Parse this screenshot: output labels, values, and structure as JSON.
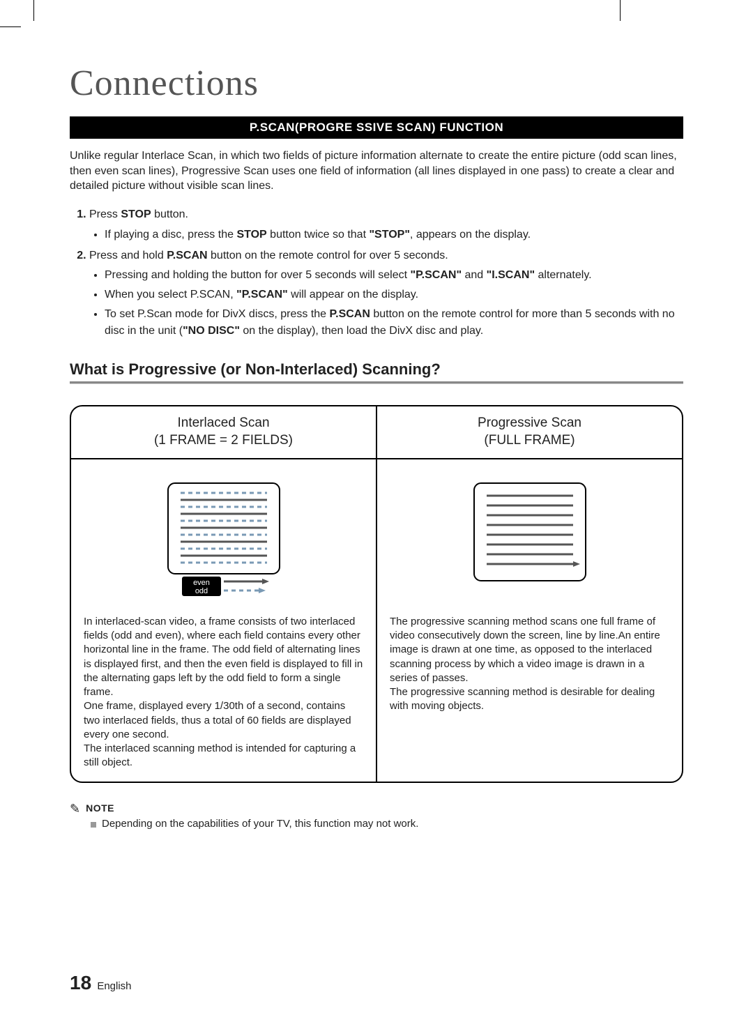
{
  "title": "Connections",
  "bar_heading": "P.SCAN(PROGRE SSIVE SCAN) FUNCTION",
  "intro": "Unlike regular Interlace Scan, in which two fields of picture information alternate to create the entire picture (odd scan lines, then even scan lines), Progressive Scan uses one field of information (all lines displayed in one pass) to create a clear and detailed picture without visible scan lines.",
  "steps": {
    "s1_pre": "Press ",
    "s1_bold": "STOP",
    "s1_post": " button.",
    "s1_b1_pre": "If playing a disc, press the ",
    "s1_b1_mid1": "STOP",
    "s1_b1_mid2": " button twice so that ",
    "s1_b1_mid3": "\"STOP\"",
    "s1_b1_post": ", appears on the display.",
    "s2_pre": "Press and hold ",
    "s2_bold": "P.SCAN",
    "s2_post": " button on the remote control for over 5 seconds.",
    "s2_b1_pre": "Pressing and holding the button for over 5 seconds will select ",
    "s2_b1_b1": "\"P.SCAN\"",
    "s2_b1_mid": " and ",
    "s2_b1_b2": "\"I.SCAN\"",
    "s2_b1_post": " alternately.",
    "s2_b2_pre": "When you select P.SCAN, ",
    "s2_b2_b": "\"P.SCAN\"",
    "s2_b2_post": " will appear on the display.",
    "s2_b3_pre": "To set P.Scan mode for DivX discs, press the ",
    "s2_b3_b1": "P.SCAN",
    "s2_b3_mid": " button on the remote control for more than 5 seconds with no disc in the unit (",
    "s2_b3_b2": "\"NO DISC\"",
    "s2_b3_post": " on the display), then load the DivX disc and play."
  },
  "subhead": "What is Progressive (or Non-Interlaced) Scanning?",
  "panel": {
    "left_title1": "Interlaced Scan",
    "left_title2": "(1 FRAME = 2 FIELDS)",
    "right_title1": "Progressive Scan",
    "right_title2": "(FULL FRAME)",
    "left_desc": "In interlaced-scan video, a frame consists of two interlaced fields (odd and even), where each field contains every other horizontal line in the frame. The odd field of alternating lines is displayed first, and then the even field is displayed to fill in the alternating gaps left by the odd field to form a single frame.\nOne frame, displayed every 1/30th of a second, contains two interlaced fields, thus a total of 60 fields are displayed every one second.\nThe interlaced scanning method is intended for capturing a still object.",
    "right_desc": "The progressive scanning method scans one full frame of video consecutively down the screen, line by line.An entire image is drawn at one time, as opposed to the interlaced scanning process by which a video image is drawn in a series of passes.\nThe progressive scanning method is desirable for dealing with moving objects.",
    "even_label": "even",
    "odd_label": "odd"
  },
  "note_label": "NOTE",
  "note_text": "Depending on the capabilities of your TV, this function may not work.",
  "page_number": "18",
  "page_lang": "English"
}
